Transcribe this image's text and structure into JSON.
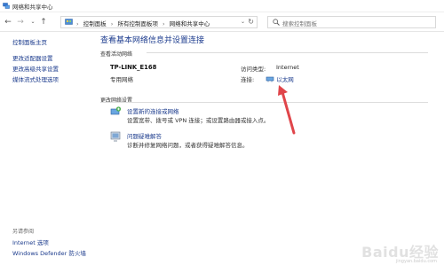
{
  "window": {
    "title": "网络和共享中心",
    "icon": "network-sharing-icon"
  },
  "nav": {
    "back": "←",
    "forward": "→",
    "dropdown": "⌄",
    "up": "↑",
    "breadcrumbs": [
      "控制面板",
      "所有控制面板项",
      "网络和共享中心"
    ],
    "separator": "›",
    "search_placeholder": "搜索控制面板"
  },
  "sidebar": {
    "home": "控制面板主页",
    "items": [
      "更改适配器设置",
      "更改高级共享设置",
      "媒体流式处理选项"
    ],
    "see_also_label": "另请参阅",
    "see_also": [
      "Internet 选项",
      "Windows Defender 防火墙"
    ]
  },
  "main": {
    "title": "查看基本网络信息并设置连接",
    "active_section": "查看活动网络",
    "network_name": "TP-LINK_E168",
    "network_type": "专用网络",
    "access_type_label": "访问类型:",
    "access_type_value": "Internet",
    "connections_label": "连接:",
    "connection_value": "以太网",
    "change_section": "更改网络设置",
    "tasks": [
      {
        "title": "设置新的连接或网络",
        "desc": "设置宽带、拨号或 VPN 连接；或设置路由器或接入点。",
        "icon": "new-connection-icon"
      },
      {
        "title": "问题疑难解答",
        "desc": "诊断并修复网络问题，或者获得疑难解答信息。",
        "icon": "troubleshoot-icon"
      }
    ]
  },
  "watermark": {
    "text": "Baidu经验",
    "sub": "jingyan.baidu.com"
  },
  "colors": {
    "link": "#1a3a8c",
    "title": "#1e3d8f",
    "arrow": "#e0454a"
  }
}
